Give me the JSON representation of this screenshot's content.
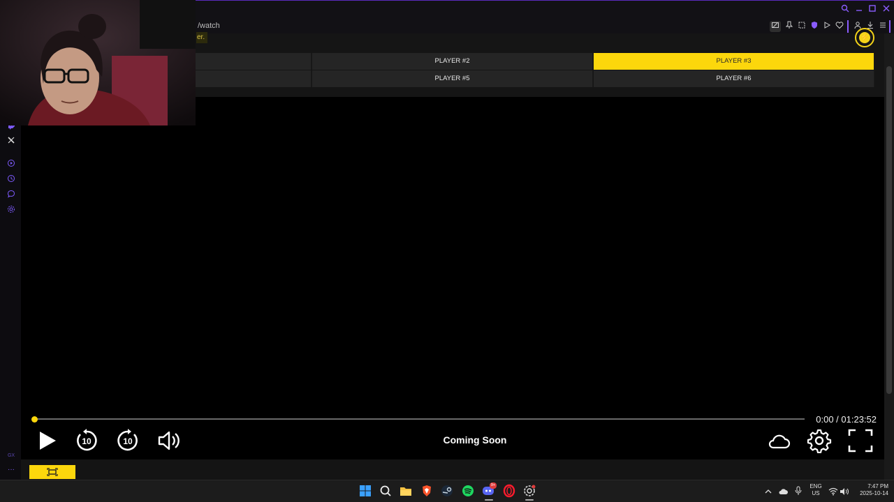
{
  "browser": {
    "url_fragment": "/watch",
    "window_controls": [
      "search-icon",
      "minimize-icon",
      "maximize-icon",
      "close-icon"
    ],
    "toolbar_icons": [
      "screenshot-icon",
      "pin-icon",
      "snapshot-icon",
      "shield-icon",
      "play-icon",
      "heart-icon",
      "account-icon",
      "download-icon",
      "menu-icon"
    ]
  },
  "sidebar": {
    "icons": [
      "twitch-icon",
      "x-icon",
      "player-icon",
      "history-icon",
      "messenger-icon",
      "settings-icon"
    ],
    "gx_label": "GX",
    "more_label": "···"
  },
  "page": {
    "notice_fragment": "er.",
    "players": [
      {
        "label": "",
        "active": false
      },
      {
        "label": "PLAYER #2",
        "active": false
      },
      {
        "label": "PLAYER #3",
        "active": true
      },
      {
        "label": "",
        "active": false
      },
      {
        "label": "PLAYER #5",
        "active": false
      },
      {
        "label": "PLAYER #6",
        "active": false
      }
    ]
  },
  "player": {
    "time": "0:00 / 01:23:52",
    "progress": 0,
    "status": "Coming Soon",
    "rewind_label": "10",
    "forward_label": "10"
  },
  "taskbar": {
    "apps": [
      "windows-start",
      "search",
      "file-explorer",
      "brave",
      "steam",
      "spotify",
      "discord",
      "opera",
      "opera-gx"
    ],
    "discord_badge": "9+",
    "lang_line1": "ENG",
    "lang_line2": "US",
    "time": "7:47 PM",
    "date": "2025-10-14"
  },
  "colors": {
    "accent": "#fcd70c",
    "browser_accent": "#7e5bff"
  }
}
